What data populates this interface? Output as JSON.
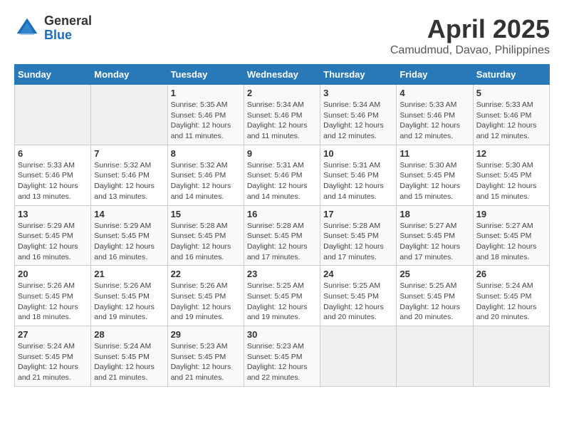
{
  "header": {
    "logo_general": "General",
    "logo_blue": "Blue",
    "month": "April 2025",
    "location": "Camudmud, Davao, Philippines"
  },
  "weekdays": [
    "Sunday",
    "Monday",
    "Tuesday",
    "Wednesday",
    "Thursday",
    "Friday",
    "Saturday"
  ],
  "weeks": [
    [
      {
        "day": "",
        "sunrise": "",
        "sunset": "",
        "daylight": ""
      },
      {
        "day": "",
        "sunrise": "",
        "sunset": "",
        "daylight": ""
      },
      {
        "day": "1",
        "sunrise": "Sunrise: 5:35 AM",
        "sunset": "Sunset: 5:46 PM",
        "daylight": "Daylight: 12 hours and 11 minutes."
      },
      {
        "day": "2",
        "sunrise": "Sunrise: 5:34 AM",
        "sunset": "Sunset: 5:46 PM",
        "daylight": "Daylight: 12 hours and 11 minutes."
      },
      {
        "day": "3",
        "sunrise": "Sunrise: 5:34 AM",
        "sunset": "Sunset: 5:46 PM",
        "daylight": "Daylight: 12 hours and 12 minutes."
      },
      {
        "day": "4",
        "sunrise": "Sunrise: 5:33 AM",
        "sunset": "Sunset: 5:46 PM",
        "daylight": "Daylight: 12 hours and 12 minutes."
      },
      {
        "day": "5",
        "sunrise": "Sunrise: 5:33 AM",
        "sunset": "Sunset: 5:46 PM",
        "daylight": "Daylight: 12 hours and 12 minutes."
      }
    ],
    [
      {
        "day": "6",
        "sunrise": "Sunrise: 5:33 AM",
        "sunset": "Sunset: 5:46 PM",
        "daylight": "Daylight: 12 hours and 13 minutes."
      },
      {
        "day": "7",
        "sunrise": "Sunrise: 5:32 AM",
        "sunset": "Sunset: 5:46 PM",
        "daylight": "Daylight: 12 hours and 13 minutes."
      },
      {
        "day": "8",
        "sunrise": "Sunrise: 5:32 AM",
        "sunset": "Sunset: 5:46 PM",
        "daylight": "Daylight: 12 hours and 14 minutes."
      },
      {
        "day": "9",
        "sunrise": "Sunrise: 5:31 AM",
        "sunset": "Sunset: 5:46 PM",
        "daylight": "Daylight: 12 hours and 14 minutes."
      },
      {
        "day": "10",
        "sunrise": "Sunrise: 5:31 AM",
        "sunset": "Sunset: 5:46 PM",
        "daylight": "Daylight: 12 hours and 14 minutes."
      },
      {
        "day": "11",
        "sunrise": "Sunrise: 5:30 AM",
        "sunset": "Sunset: 5:45 PM",
        "daylight": "Daylight: 12 hours and 15 minutes."
      },
      {
        "day": "12",
        "sunrise": "Sunrise: 5:30 AM",
        "sunset": "Sunset: 5:45 PM",
        "daylight": "Daylight: 12 hours and 15 minutes."
      }
    ],
    [
      {
        "day": "13",
        "sunrise": "Sunrise: 5:29 AM",
        "sunset": "Sunset: 5:45 PM",
        "daylight": "Daylight: 12 hours and 16 minutes."
      },
      {
        "day": "14",
        "sunrise": "Sunrise: 5:29 AM",
        "sunset": "Sunset: 5:45 PM",
        "daylight": "Daylight: 12 hours and 16 minutes."
      },
      {
        "day": "15",
        "sunrise": "Sunrise: 5:28 AM",
        "sunset": "Sunset: 5:45 PM",
        "daylight": "Daylight: 12 hours and 16 minutes."
      },
      {
        "day": "16",
        "sunrise": "Sunrise: 5:28 AM",
        "sunset": "Sunset: 5:45 PM",
        "daylight": "Daylight: 12 hours and 17 minutes."
      },
      {
        "day": "17",
        "sunrise": "Sunrise: 5:28 AM",
        "sunset": "Sunset: 5:45 PM",
        "daylight": "Daylight: 12 hours and 17 minutes."
      },
      {
        "day": "18",
        "sunrise": "Sunrise: 5:27 AM",
        "sunset": "Sunset: 5:45 PM",
        "daylight": "Daylight: 12 hours and 17 minutes."
      },
      {
        "day": "19",
        "sunrise": "Sunrise: 5:27 AM",
        "sunset": "Sunset: 5:45 PM",
        "daylight": "Daylight: 12 hours and 18 minutes."
      }
    ],
    [
      {
        "day": "20",
        "sunrise": "Sunrise: 5:26 AM",
        "sunset": "Sunset: 5:45 PM",
        "daylight": "Daylight: 12 hours and 18 minutes."
      },
      {
        "day": "21",
        "sunrise": "Sunrise: 5:26 AM",
        "sunset": "Sunset: 5:45 PM",
        "daylight": "Daylight: 12 hours and 19 minutes."
      },
      {
        "day": "22",
        "sunrise": "Sunrise: 5:26 AM",
        "sunset": "Sunset: 5:45 PM",
        "daylight": "Daylight: 12 hours and 19 minutes."
      },
      {
        "day": "23",
        "sunrise": "Sunrise: 5:25 AM",
        "sunset": "Sunset: 5:45 PM",
        "daylight": "Daylight: 12 hours and 19 minutes."
      },
      {
        "day": "24",
        "sunrise": "Sunrise: 5:25 AM",
        "sunset": "Sunset: 5:45 PM",
        "daylight": "Daylight: 12 hours and 20 minutes."
      },
      {
        "day": "25",
        "sunrise": "Sunrise: 5:25 AM",
        "sunset": "Sunset: 5:45 PM",
        "daylight": "Daylight: 12 hours and 20 minutes."
      },
      {
        "day": "26",
        "sunrise": "Sunrise: 5:24 AM",
        "sunset": "Sunset: 5:45 PM",
        "daylight": "Daylight: 12 hours and 20 minutes."
      }
    ],
    [
      {
        "day": "27",
        "sunrise": "Sunrise: 5:24 AM",
        "sunset": "Sunset: 5:45 PM",
        "daylight": "Daylight: 12 hours and 21 minutes."
      },
      {
        "day": "28",
        "sunrise": "Sunrise: 5:24 AM",
        "sunset": "Sunset: 5:45 PM",
        "daylight": "Daylight: 12 hours and 21 minutes."
      },
      {
        "day": "29",
        "sunrise": "Sunrise: 5:23 AM",
        "sunset": "Sunset: 5:45 PM",
        "daylight": "Daylight: 12 hours and 21 minutes."
      },
      {
        "day": "30",
        "sunrise": "Sunrise: 5:23 AM",
        "sunset": "Sunset: 5:45 PM",
        "daylight": "Daylight: 12 hours and 22 minutes."
      },
      {
        "day": "",
        "sunrise": "",
        "sunset": "",
        "daylight": ""
      },
      {
        "day": "",
        "sunrise": "",
        "sunset": "",
        "daylight": ""
      },
      {
        "day": "",
        "sunrise": "",
        "sunset": "",
        "daylight": ""
      }
    ]
  ]
}
